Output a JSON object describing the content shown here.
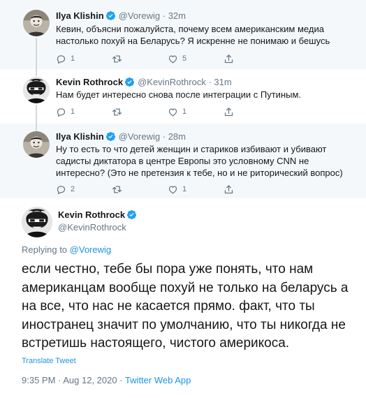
{
  "colors": {
    "link": "#1b95e0",
    "muted": "#657786",
    "text": "#14171a",
    "highlight_bg": "#f5f8fa"
  },
  "tweets": [
    {
      "name": "Ilya Klishin",
      "handle": "@Vorewig",
      "sep": "·",
      "time": "32m",
      "text": "Кевин, объясни пожалуйста, почему всем американским медиа настолько похуй на Беларусь? Я искренне не понимаю и бешусь",
      "replies": "1",
      "retweets": "",
      "likes": "5"
    },
    {
      "name": "Kevin Rothrock",
      "handle": "@KevinRothrock",
      "sep": "·",
      "time": "31m",
      "text": "Нам будет интересно снова после интеграции с Путиным.",
      "replies": "1",
      "retweets": "",
      "likes": "1"
    },
    {
      "name": "Ilya Klishin",
      "handle": "@Vorewig",
      "sep": "·",
      "time": "28m",
      "text": "Ну то есть то что детей женщин и стариков избивают и убивают садисты диктатора в центре Европы это условному CNN не интересно? (Это не претензия к тебе, но и не риторический вопрос)",
      "replies": "2",
      "retweets": "",
      "likes": "1"
    }
  ],
  "main": {
    "name": "Kevin Rothrock",
    "handle": "@KevinRothrock",
    "replying_prefix": "Replying to",
    "replying_to": "@Vorewig",
    "text": "если честно, тебе бы пора уже понять, что нам американцам вообще похуй не только на беларусь а на все, что нас не касается прямо. факт, что ты иностранец значит по умолчанию, что ты никогда не встретишь настоящего, чистого америкоса.",
    "translate": "Translate Tweet",
    "timestamp": "9:35 PM · Aug 12, 2020 ·",
    "source": "Twitter Web App"
  },
  "icons": [
    "verified-badge-icon",
    "reply-icon",
    "retweet-icon",
    "like-icon",
    "share-icon"
  ]
}
